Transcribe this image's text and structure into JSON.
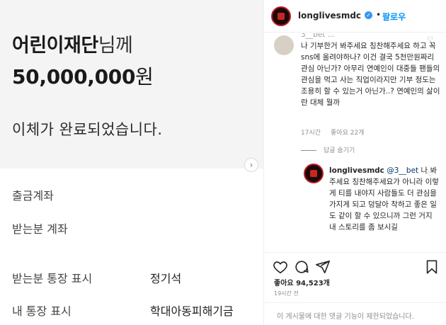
{
  "transfer": {
    "recipient": "어린이재단",
    "recipient_suffix": "님께",
    "amount": "50,000,000",
    "amount_unit": "원",
    "message": "이체가 완료되었습니다.",
    "rows": [
      {
        "label": "출금계좌",
        "value": ""
      },
      {
        "label": "받는분 계좌",
        "value": ""
      },
      {
        "label": "받는분 통장 표시",
        "value": "정기석"
      },
      {
        "label": "내 통장 표시",
        "value": "학대아동피해기금"
      }
    ]
  },
  "post": {
    "username": "longlivesmdc",
    "follow_label": "팔로우",
    "dot": "•",
    "comment1": {
      "partial": "3__bet  ...",
      "text": "나 기부한거 봐주세요 칭찬해주세요 하고 꼭 sns에 올려야하나? 이건 결국 5천만원짜리 관심 아닌가? 아무리 연예인이 대중들 팬들의 관심을 먹고 사는 직업이라지만 기부 정도는 조용히 할 수 있는거 아닌가..? 연예인의 삶이란 대체 뭘까",
      "time": "17시간",
      "likes": "좋아요 22개"
    },
    "hide_replies": "답글 숨기기",
    "reply1": {
      "username": "longlivesmdc",
      "mention": "@3__bet",
      "text": "나 봐주세요 칭찬해주세요가 아니라 이렇게 티를 내야지 사람들도 더 관심을 가지게 되고 덩달아 착하고 좋은 일도 같이 할 수 있으니까 그런 거지 내 스토리를 좀 보시길"
    },
    "likes_total": "좋아요 94,523개",
    "posted_time": "19시간 전",
    "comments_disabled": "이 게시물에 대한 댓글 기능이 제한되었습니다."
  },
  "colors": {
    "accent": "#0095f6",
    "verified": "#3897f0"
  },
  "icons": [
    "chevron-right-icon",
    "heart-icon",
    "comment-icon",
    "share-icon",
    "bookmark-icon",
    "verified-badge-icon"
  ]
}
